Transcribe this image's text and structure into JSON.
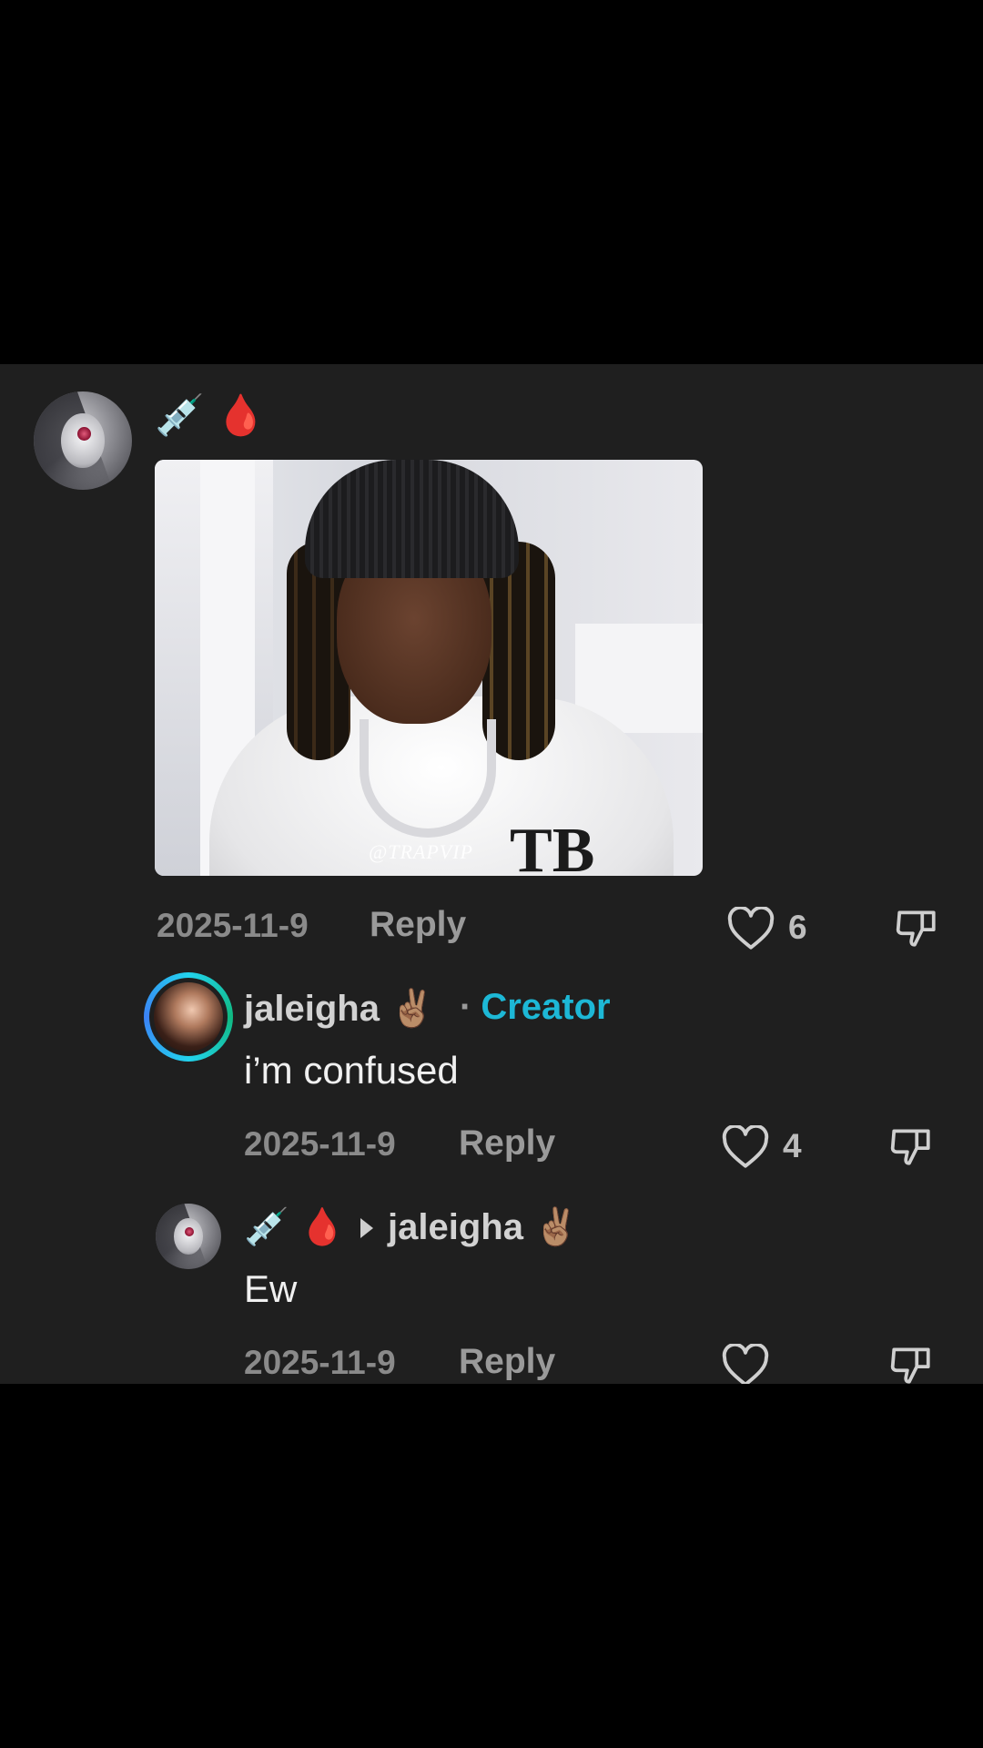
{
  "comment": {
    "username_emojis": "💉 🩸",
    "date": "2025-11-9",
    "reply_label": "Reply",
    "like_count": "6",
    "photo_watermark": "@TRAPVIP"
  },
  "replies": [
    {
      "username": "jaleigha",
      "username_emoji": "✌🏽",
      "badge": "Creator",
      "badge_separator": "·",
      "text": "i’m confused",
      "date": "2025-11-9",
      "reply_label": "Reply",
      "like_count": "4"
    },
    {
      "username_emojis": "💉 🩸",
      "reply_to": "jaleigha",
      "reply_to_emoji": "✌🏽",
      "text": "Ew",
      "date": "2025-11-9",
      "reply_label": "Reply",
      "like_count": ""
    }
  ],
  "colors": {
    "panel_bg": "#1f1f1f",
    "creator_badge": "#1db8d6",
    "muted": "#8a8a8a"
  },
  "icons": {
    "like": "heart-outline-icon",
    "dislike": "thumbs-down-icon",
    "reply_arrow": "triangle-right-icon"
  }
}
